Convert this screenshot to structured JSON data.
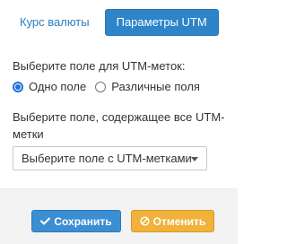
{
  "tabs": [
    {
      "label": "Курс валюты",
      "active": false
    },
    {
      "label": "Параметры UTM",
      "active": true
    }
  ],
  "field_mode": {
    "label": "Выберите поле для UTM-меток:",
    "options": [
      {
        "label": "Одно поле",
        "checked": true
      },
      {
        "label": "Различные поля",
        "checked": false
      }
    ]
  },
  "field_select": {
    "label": "Выберите поле, содержащее все UTM-метки",
    "selected": "Выберите поле с UTM-метками"
  },
  "buttons": {
    "save_label": "Сохранить",
    "cancel_label": "Отменить"
  },
  "colors": {
    "accent": "#2d84c9",
    "link": "#2a7fc1",
    "save": "#3c8ed3",
    "cancel": "#f0b23a"
  },
  "icons": {
    "save": "check-icon",
    "cancel": "ban-icon",
    "select": "chevron-down-icon"
  }
}
